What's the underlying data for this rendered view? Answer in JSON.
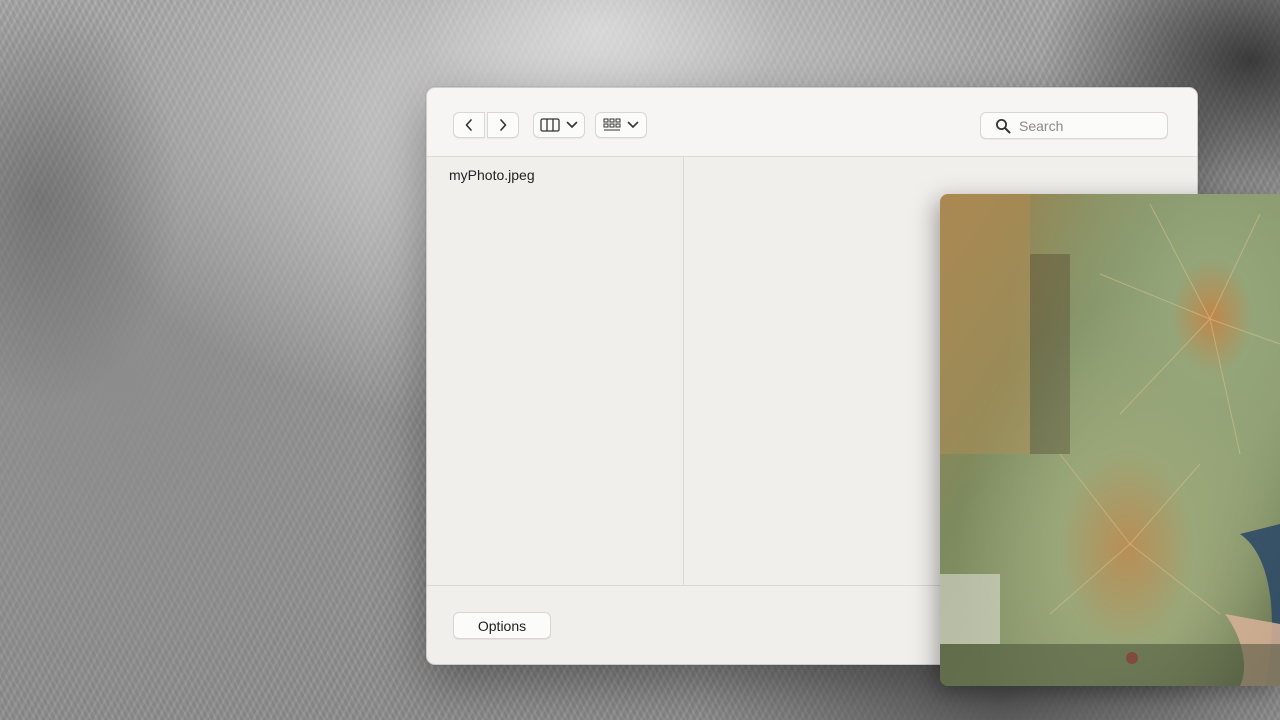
{
  "dialog": {
    "toolbar": {
      "back_icon": "chevron-left-icon",
      "forward_icon": "chevron-right-icon",
      "view_icon": "column-view-icon",
      "group_icon": "grid-view-icon",
      "dropdown_icon": "chevron-down-icon",
      "search": {
        "icon": "magnifying-glass-icon",
        "placeholder": "Search",
        "value": ""
      }
    },
    "files": [
      {
        "name": "myPhoto.jpeg"
      }
    ],
    "footer": {
      "options_label": "Options"
    }
  },
  "preview": {
    "icon": "photo-preview",
    "colors": {
      "green": "#7f9a6c",
      "tan": "#c39a5e",
      "dark": "#4f4a36"
    }
  }
}
